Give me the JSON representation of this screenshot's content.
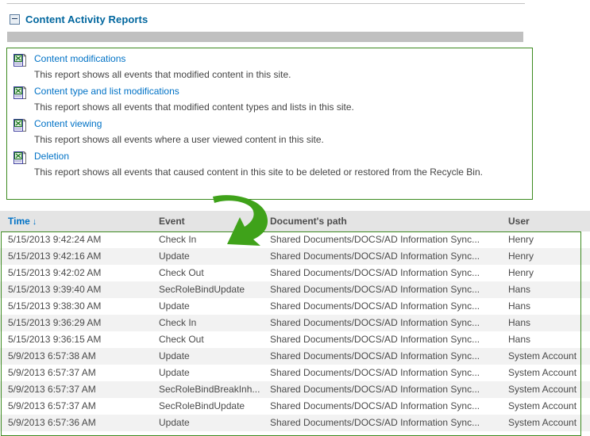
{
  "webpart": {
    "title": "Content Activity Reports",
    "collapse_icon": "collapse-minus-icon"
  },
  "reports": [
    {
      "icon": "excel-report-icon",
      "link": "Content modifications",
      "description": "This report shows all events that modified content in this site."
    },
    {
      "icon": "excel-report-icon",
      "link": "Content type and list modifications",
      "description": "This report shows all events that modified content types and lists in this site."
    },
    {
      "icon": "excel-report-icon",
      "link": "Content viewing",
      "description": "This report shows all events where a user viewed content in this site."
    },
    {
      "icon": "excel-report-icon",
      "link": "Deletion",
      "description": "This report shows all events that caused content in this site to be deleted or restored from the Recycle Bin."
    }
  ],
  "table": {
    "columns": [
      {
        "label": "Time",
        "sorted": true,
        "sort_indicator": "↓"
      },
      {
        "label": "Event",
        "sorted": false,
        "sort_indicator": ""
      },
      {
        "label": "Document's path",
        "sorted": false,
        "sort_indicator": ""
      },
      {
        "label": "User",
        "sorted": false,
        "sort_indicator": ""
      }
    ],
    "rows": [
      {
        "time": "5/15/2013 9:42:24 AM",
        "event": "Check In",
        "path": "Shared Documents/DOCS/AD Information Sync...",
        "user": "Henry"
      },
      {
        "time": "5/15/2013 9:42:16 AM",
        "event": "Update",
        "path": "Shared Documents/DOCS/AD Information Sync...",
        "user": "Henry"
      },
      {
        "time": "5/15/2013 9:42:02 AM",
        "event": "Check Out",
        "path": "Shared Documents/DOCS/AD Information Sync...",
        "user": "Henry"
      },
      {
        "time": "5/15/2013 9:39:40 AM",
        "event": "SecRoleBindUpdate",
        "path": "Shared Documents/DOCS/AD Information Sync...",
        "user": "Hans"
      },
      {
        "time": "5/15/2013 9:38:30 AM",
        "event": "Update",
        "path": "Shared Documents/DOCS/AD Information Sync...",
        "user": "Hans"
      },
      {
        "time": "5/15/2013 9:36:29 AM",
        "event": "Check In",
        "path": "Shared Documents/DOCS/AD Information Sync...",
        "user": "Hans"
      },
      {
        "time": "5/15/2013 9:36:15 AM",
        "event": "Check Out",
        "path": "Shared Documents/DOCS/AD Information Sync...",
        "user": "Hans"
      },
      {
        "time": "5/9/2013 6:57:38 AM",
        "event": "Update",
        "path": "Shared Documents/DOCS/AD Information Sync...",
        "user": "System Account"
      },
      {
        "time": "5/9/2013 6:57:37 AM",
        "event": "Update",
        "path": "Shared Documents/DOCS/AD Information Sync...",
        "user": "System Account"
      },
      {
        "time": "5/9/2013 6:57:37 AM",
        "event": "SecRoleBindBreakInh...",
        "path": "Shared Documents/DOCS/AD Information Sync...",
        "user": "System Account"
      },
      {
        "time": "5/9/2013 6:57:37 AM",
        "event": "SecRoleBindUpdate",
        "path": "Shared Documents/DOCS/AD Information Sync...",
        "user": "System Account"
      },
      {
        "time": "5/9/2013 6:57:36 AM",
        "event": "Update",
        "path": "Shared Documents/DOCS/AD Information Sync...",
        "user": "System Account"
      }
    ]
  },
  "annotation": {
    "arrow_icon": "curved-arrow-icon",
    "color": "#3fa21a"
  },
  "colors": {
    "link_blue": "#0072c6",
    "title_blue": "#00669e",
    "green_border": "#3c8a20",
    "annotation_green": "#3fa21a",
    "header_grey": "#e4e4e4",
    "bar_grey": "#c0c0c0",
    "row_alt_grey": "#f2f2f2"
  }
}
